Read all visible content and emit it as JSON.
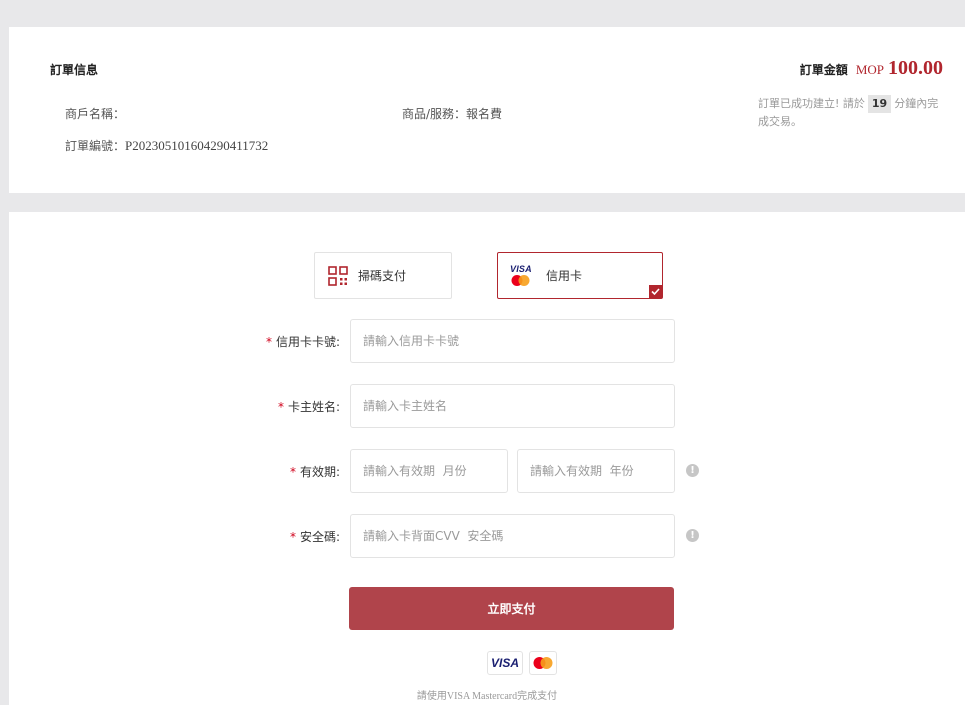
{
  "order": {
    "title": "訂單信息",
    "merchant_label": "商戶名稱：",
    "merchant_value": "",
    "order_no_label": "訂單編號：",
    "order_no_value": "P20230510160429041173 2",
    "product_label": "商品/服務：",
    "product_value": "報名費",
    "amount_label": "訂單金額",
    "currency": "MOP",
    "amount": "100.00",
    "status_prefix": "訂單已成功建立! 請於",
    "minutes": "19",
    "status_suffix": "分鐘內完成交易。"
  },
  "tabs": [
    {
      "label": "掃碼支付",
      "icon": "qr-code-icon",
      "selected": false
    },
    {
      "label": "信用卡",
      "icon": "visa-mastercard-icon",
      "selected": true,
      "visa_text": "VISA"
    }
  ],
  "form": {
    "required_mark": "*",
    "card_number": {
      "label": "信用卡卡號:",
      "placeholder": "請輸入信用卡卡號"
    },
    "holder_name": {
      "label": "卡主姓名:",
      "placeholder": "請輸入卡主姓名"
    },
    "expiry": {
      "label": "有效期:",
      "month_placeholder": "請輸入有效期  月份",
      "year_placeholder": "請輸入有效期  年份"
    },
    "cvv": {
      "label": "安全碼:",
      "placeholder": "請輸入卡背面CVV  安全碼"
    },
    "info_icon_glyph": "!"
  },
  "submit": {
    "label": "立即支付"
  },
  "footer": {
    "visa_logo": "VISA",
    "note_prefix": "請使用",
    "note_brands": "VISA Mastercard",
    "note_suffix": "完成支付"
  },
  "colors": {
    "brand_red": "#b1262e",
    "button_red": "#b0444b",
    "visa_blue": "#1a1f71",
    "mc_red": "#eb001b",
    "mc_yellow": "#f79e1b"
  }
}
